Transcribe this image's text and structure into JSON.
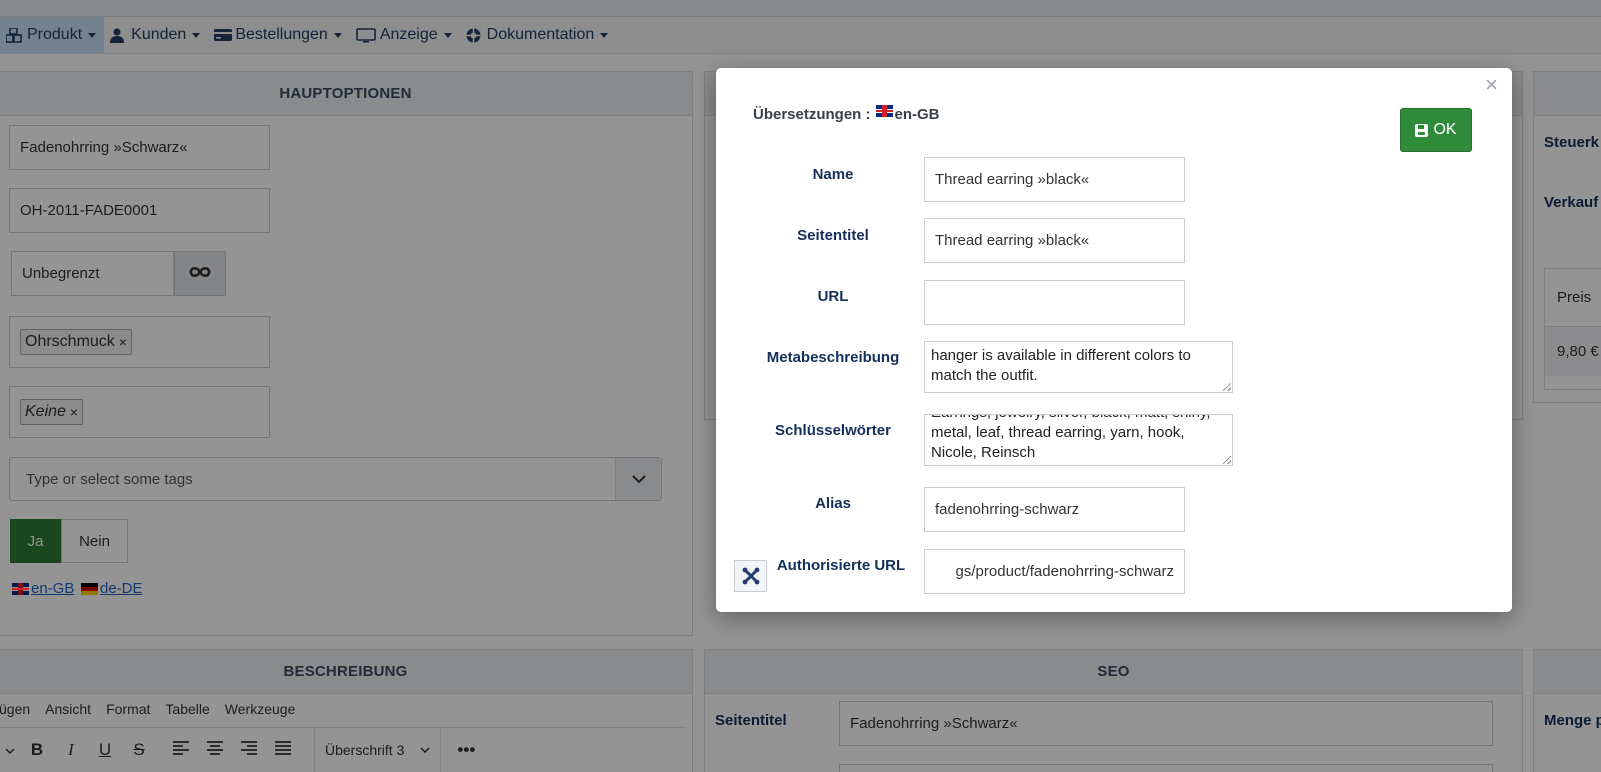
{
  "menubar": {
    "items": [
      {
        "label": "Produkt",
        "icon": "cubes-icon"
      },
      {
        "label": "Kunden",
        "icon": "user-icon"
      },
      {
        "label": "Bestellungen",
        "icon": "orders-icon"
      },
      {
        "label": "Anzeige",
        "icon": "monitor-icon"
      },
      {
        "label": "Dokumentation",
        "icon": "lifebuoy-icon"
      }
    ]
  },
  "main_panel": {
    "heading": "HAUPTOPTIONEN",
    "name_value": "Fadenohrring »Schwarz«",
    "sku_value": "OH-2011-FADE0001",
    "stock_value": "Unbegrenzt",
    "stock_button_icon": "infinity-icon",
    "category_tag": "Ohrschmuck",
    "manufacturer_tag": "Keine",
    "tags_placeholder": "Type or select some tags",
    "published_yes": "Ja",
    "published_no": "Nein",
    "languages": [
      "en-GB",
      "de-DE"
    ]
  },
  "right_panel": {
    "label_tax": "Steuerk",
    "label_sale": "Verkauf",
    "price_header": "Preis",
    "price_value": "9,80 €"
  },
  "description_panel": {
    "heading": "BESCHREIBUNG",
    "editor_menu": [
      "ügen",
      "Ansicht",
      "Format",
      "Tabelle",
      "Werkzeuge"
    ],
    "style_select": "Überschrift 3"
  },
  "seo_panel": {
    "heading": "SEO",
    "label_title": "Seitentitel",
    "title_value": "Fadenohrring »Schwarz«"
  },
  "far_right_panel": {
    "label_quantity": "Menge p"
  },
  "modal": {
    "title_prefix": "Übersetzungen :",
    "title_lang": "en-GB",
    "ok_label": "OK",
    "close_symbol": "×",
    "fields": {
      "name_label": "Name",
      "name_value": "Thread earring »black«",
      "page_title_label": "Seitentitel",
      "page_title_value": "Thread earring »black«",
      "url_label": "URL",
      "url_value": "",
      "meta_label": "Metabeschreibung",
      "meta_lines": [
        "hanger is available in different colors to",
        "match the outfit."
      ],
      "keywords_label": "Schlüsselwörter",
      "keywords_lines": [
        "Earrings, jewelry, silver, black, matt, shiny,",
        "metal, leaf, thread earring, yarn, hook,",
        "Nicole, Reinsch"
      ],
      "alias_label": "Alias",
      "alias_value": "fadenohrring-schwarz",
      "auth_url_label": "Authorisierte URL",
      "auth_url_value": "gs/product/fadenohrring-schwarz"
    }
  }
}
